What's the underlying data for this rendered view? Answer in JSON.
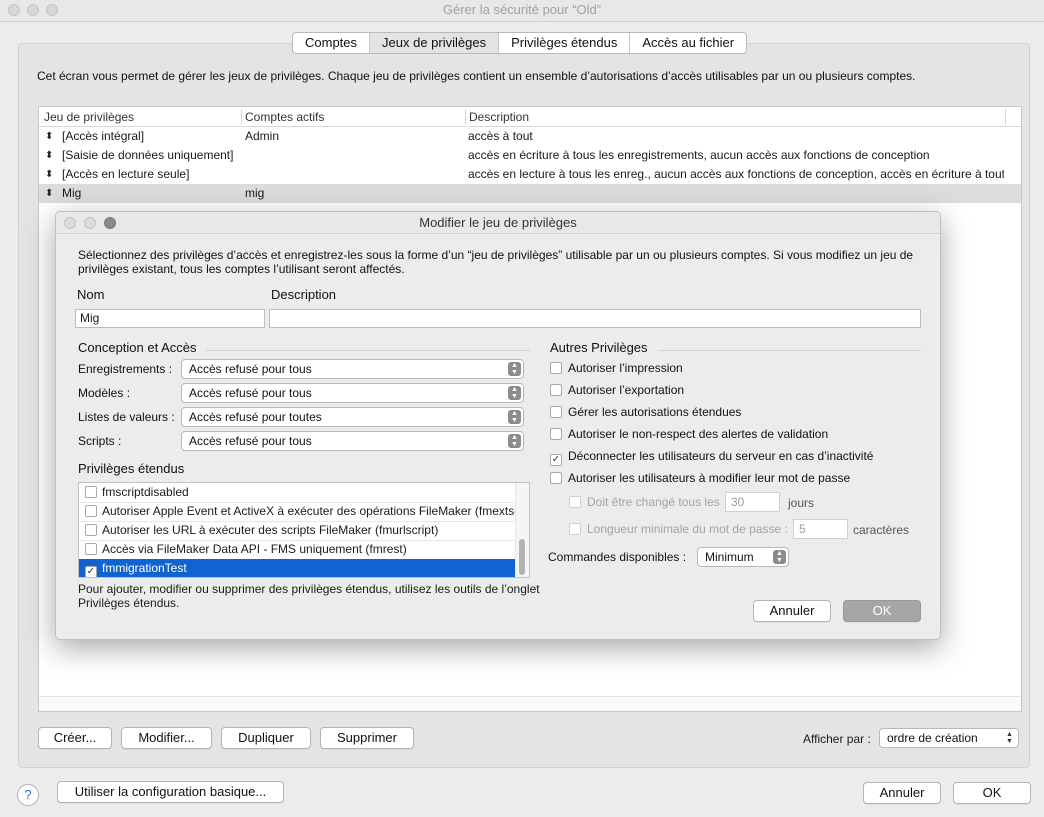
{
  "window": {
    "title": "Gérer la sécurité pour “Old”",
    "tabs": [
      "Comptes",
      "Jeux de privilèges",
      "Privilèges étendus",
      "Accès au fichier"
    ],
    "intro": "Cet écran vous permet de gérer les jeux de privilèges. Chaque jeu de privilèges contient un ensemble d’autorisations d’accès utilisables par un ou plusieurs comptes."
  },
  "table": {
    "columns": [
      "Jeu de privilèges",
      "Comptes actifs",
      "Description"
    ],
    "rows": [
      {
        "name": "[Accès intégral]",
        "accounts": "Admin",
        "description": "accès à tout"
      },
      {
        "name": "[Saisie de données uniquement]",
        "accounts": "",
        "description": "accès en écriture à tous les enregistrements, aucun accès aux fonctions de conception"
      },
      {
        "name": "[Accès en lecture seule]",
        "accounts": "",
        "description": "accès en lecture à tous les enreg., aucun accès aux fonctions de conception, accès en écriture à toute…"
      },
      {
        "name": "Mig",
        "accounts": "mig",
        "description": ""
      }
    ],
    "selected_row": 3
  },
  "bottom": {
    "create": "Créer...",
    "modify": "Modifier...",
    "duplicate": "Dupliquer",
    "delete": "Supprimer",
    "sort_label": "Afficher par :",
    "sort_value": "ordre de création",
    "basic_config": "Utiliser la configuration basique...",
    "cancel": "Annuler",
    "ok": "OK",
    "help": "?"
  },
  "modal": {
    "title": "Modifier le jeu de privilèges",
    "description": "Sélectionnez des privilèges d’accès et enregistrez-les sous la forme d’un “jeu de privilèges” utilisable par un ou plusieurs comptes. Si vous modifiez un jeu de privilèges existant, tous les comptes l’utilisant seront affectés.",
    "name_label": "Nom",
    "name_value": "Mig",
    "desc_label": "Description",
    "desc_value": "",
    "design_section": "Conception et Accès",
    "design_rows": [
      {
        "label": "Enregistrements :",
        "value": "Accès refusé pour tous"
      },
      {
        "label": "Modèles :",
        "value": "Accès refusé pour tous"
      },
      {
        "label": "Listes de valeurs :",
        "value": "Accès refusé pour toutes"
      },
      {
        "label": "Scripts :",
        "value": "Accès refusé pour tous"
      }
    ],
    "ext_section": "Privilèges étendus",
    "ext_items": [
      {
        "label": "fmscriptdisabled",
        "checked": false
      },
      {
        "label": "Autoriser Apple Event et ActiveX à exécuter des opérations FileMaker (fmextscriptaccess)",
        "checked": false
      },
      {
        "label": "Autoriser les URL à exécuter des scripts FileMaker (fmurlscript)",
        "checked": false
      },
      {
        "label": "Accès via FileMaker Data API - FMS uniquement (fmrest)",
        "checked": false
      },
      {
        "label": "fmmigrationTest",
        "checked": true
      }
    ],
    "ext_note": "Pour ajouter, modifier ou supprimer des privilèges étendus, utilisez les outils de l’onglet Privilèges étendus.",
    "other_section": "Autres Privilèges",
    "other_items": [
      {
        "label": "Autoriser l’impression",
        "checked": false
      },
      {
        "label": "Autoriser l’exportation",
        "checked": false
      },
      {
        "label": "Gérer les autorisations étendues",
        "checked": false
      },
      {
        "label": "Autoriser le non-respect des alertes de validation",
        "checked": false
      },
      {
        "label": "Déconnecter les utilisateurs du serveur en cas d’inactivité",
        "checked": true
      },
      {
        "label": "Autoriser les utilisateurs à modifier leur mot de passe",
        "checked": false
      }
    ],
    "pw_change_label": "Doit être changé tous les",
    "pw_change_value": "30",
    "pw_change_unit": "jours",
    "pw_len_label": "Longueur minimale du mot de passe :",
    "pw_len_value": "5",
    "pw_len_unit": "caractères",
    "commands_label": "Commandes disponibles :",
    "commands_value": "Minimum",
    "cancel": "Annuler",
    "ok": "OK"
  }
}
